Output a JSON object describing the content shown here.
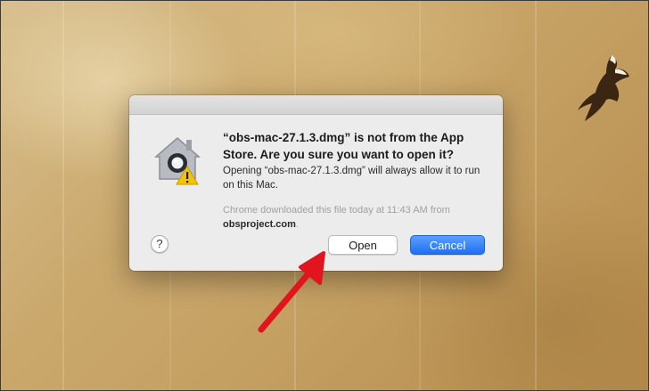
{
  "dialog": {
    "headline": "“obs-mac-27.1.3.dmg” is not from the App Store. Are you sure you want to open it?",
    "message": "Opening “obs-mac-27.1.3.dmg” will always allow it to run on this Mac.",
    "source_prefix": "Chrome downloaded this file today at 11:43 AM from",
    "source_host": "obsproject.com",
    "source_suffix": ".",
    "help_label": "?",
    "open_label": "Open",
    "cancel_label": "Cancel"
  },
  "icons": {
    "dialog_icon": "gatekeeper-warning-icon",
    "annotation": "red-arrow-icon",
    "wallpaper_bird": "eagle-icon"
  },
  "colors": {
    "accent": "#1f6ff0",
    "arrow": "#e0151e",
    "warning": "#f5c400"
  }
}
